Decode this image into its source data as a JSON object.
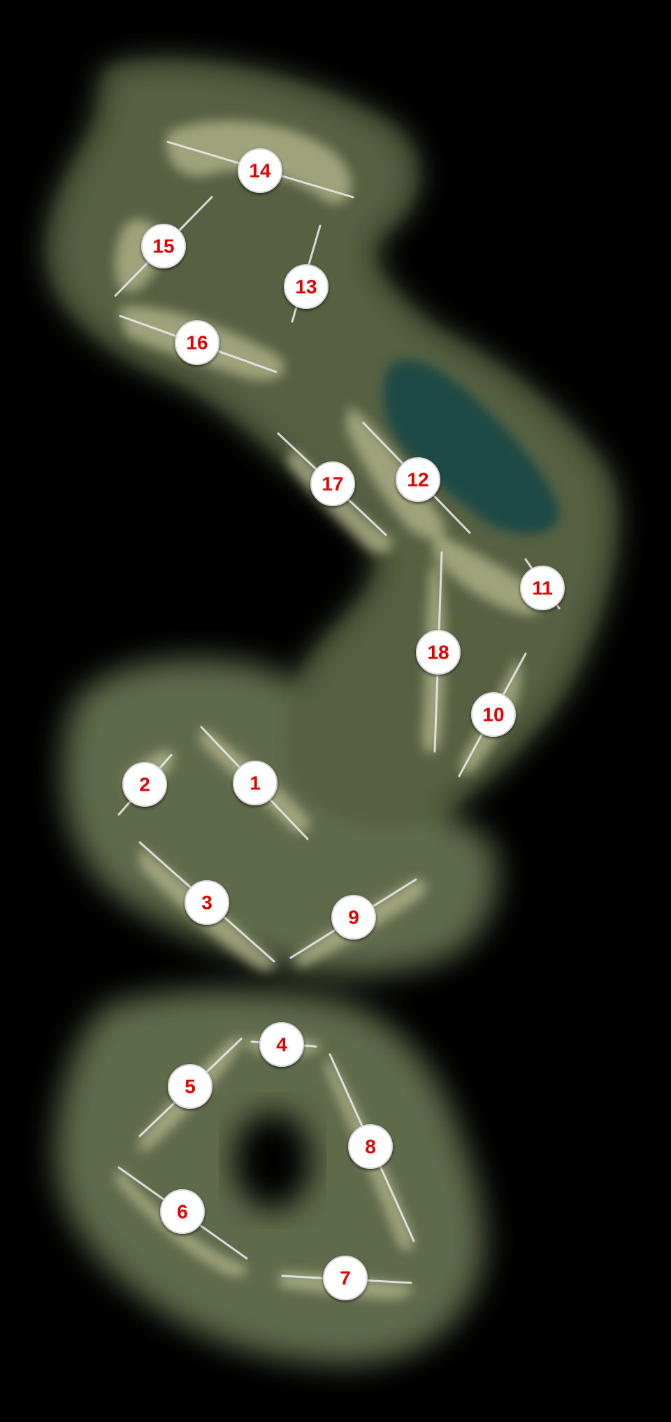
{
  "map": {
    "background_color": "#000000",
    "terrain_color": "#5f6a4c",
    "fairway_color": "#b7b98f",
    "lake_color": "#1e4a44",
    "marker_fill": "#ffffff",
    "number_color": "#e00000",
    "line_color": "#e8e8e8"
  },
  "holes": [
    {
      "label": "1"
    },
    {
      "label": "2"
    },
    {
      "label": "3"
    },
    {
      "label": "4"
    },
    {
      "label": "5"
    },
    {
      "label": "6"
    },
    {
      "label": "7"
    },
    {
      "label": "8"
    },
    {
      "label": "9"
    },
    {
      "label": "10"
    },
    {
      "label": "11"
    },
    {
      "label": "12"
    },
    {
      "label": "13"
    },
    {
      "label": "14"
    },
    {
      "label": "15"
    },
    {
      "label": "16"
    },
    {
      "label": "17"
    },
    {
      "label": "18"
    }
  ]
}
